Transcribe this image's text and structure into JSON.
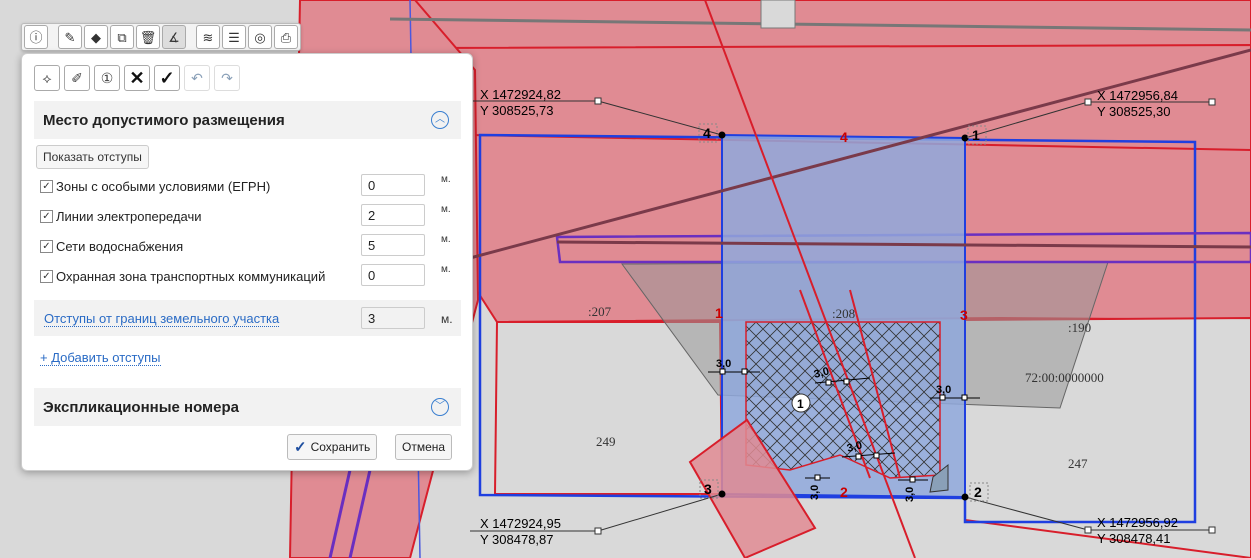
{
  "toolbar": {
    "icons": [
      "info-icon",
      "edit-icon",
      "object-edit-icon",
      "external-window-icon",
      "trash-icon",
      "measure-icon",
      "layers-icon",
      "list-icon",
      "globe-icon",
      "print-icon"
    ]
  },
  "panel_toolbar": {
    "icons": [
      "split-line-icon",
      "draw-line-icon",
      "numbering-icon",
      "close-x-icon",
      "checkmark-icon",
      "undo-icon",
      "redo-icon"
    ]
  },
  "placement_section": {
    "title": "Место допустимого размещения",
    "show_offsets_label": "Показать отступы",
    "rows": [
      {
        "label": "Зоны с особыми условиями (ЕГРН)",
        "value": "0",
        "unit": "м.",
        "checked": true
      },
      {
        "label": "Линии электропередачи",
        "value": "2",
        "unit": "м.",
        "checked": true
      },
      {
        "label": "Сети водоснабжения",
        "value": "5",
        "unit": "м.",
        "checked": true
      },
      {
        "label": "Охранная зона транспортных коммуникаций",
        "value": "0",
        "unit": "м.",
        "checked": true
      }
    ],
    "boundary_offset": {
      "label": "Отступы от границ земельного участка",
      "value": "3",
      "unit": "м."
    },
    "add_offsets_label": "+ Добавить отступы"
  },
  "explication_section": {
    "title": "Экспликационные номера"
  },
  "buttons": {
    "save_label": "Сохранить",
    "cancel_label": "Отмена"
  },
  "map": {
    "coords": {
      "tl": {
        "x": "X 1472924,82",
        "y": "Y 308525,73"
      },
      "tr": {
        "x": "X 1472956,84",
        "y": "Y 308525,30"
      },
      "bl": {
        "x": "X 1472924,95",
        "y": "Y 308478,87"
      },
      "br": {
        "x": "X 1472956,92",
        "y": "Y 308478,41"
      }
    },
    "vertex_labels": {
      "v1": "1",
      "v2": "2",
      "v3": "3",
      "v4": "4"
    },
    "edge_labels": {
      "top": "4",
      "bottom": "2",
      "left": "1",
      "right": "3"
    },
    "parcel_labels": {
      "p207": ":207",
      "p208": ":208",
      "p190": ":190",
      "cadastral": "72:00:0000000",
      "n249": "249",
      "n247": "247"
    },
    "dim_label": "3,0",
    "dim_label_rot": "3,0",
    "marker_label": "1",
    "colors": {
      "parcel_fill": "#e08b93",
      "boundary_red": "#d81e2b",
      "zone_blue": "#1f3fe0",
      "selection_blue": "#8fa8dc"
    }
  }
}
